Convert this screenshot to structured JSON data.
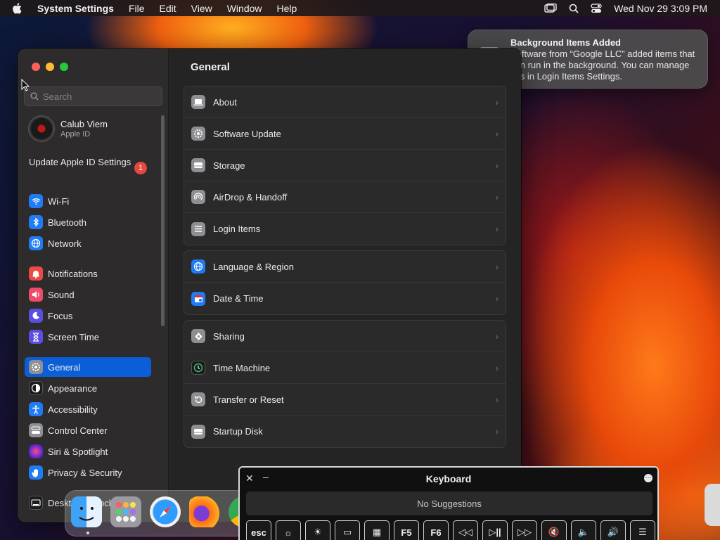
{
  "menubar": {
    "app_name": "System Settings",
    "menus": [
      "File",
      "Edit",
      "View",
      "Window",
      "Help"
    ],
    "clock": "Wed Nov 29  3:09 PM"
  },
  "sidebar": {
    "search_placeholder": "Search",
    "profile": {
      "name": "Calub Viem",
      "subtitle": "Apple ID"
    },
    "update_label": "Update Apple ID Settings",
    "update_badge": "1",
    "items": [
      {
        "label": "Wi-Fi",
        "icon": "wifi-icon",
        "color": "#1f7cf5"
      },
      {
        "label": "Bluetooth",
        "icon": "bluetooth-icon",
        "color": "#1f7cf5"
      },
      {
        "label": "Network",
        "icon": "globe-icon",
        "color": "#1f7cf5"
      },
      {
        "label": "Notifications",
        "icon": "bell-icon",
        "color": "#ee4a44"
      },
      {
        "label": "Sound",
        "icon": "speaker-icon",
        "color": "#ee4a6a"
      },
      {
        "label": "Focus",
        "icon": "moon-icon",
        "color": "#5a4fe0"
      },
      {
        "label": "Screen Time",
        "icon": "hourglass-icon",
        "color": "#5a4fe0"
      },
      {
        "label": "General",
        "icon": "gear-icon",
        "color": "#8e8e93"
      },
      {
        "label": "Appearance",
        "icon": "appearance-icon",
        "color": "#1c1c1c"
      },
      {
        "label": "Accessibility",
        "icon": "accessibility-icon",
        "color": "#1f7cf5"
      },
      {
        "label": "Control Center",
        "icon": "control-center-icon",
        "color": "#8e8e93"
      },
      {
        "label": "Siri & Spotlight",
        "icon": "siri-icon",
        "color": "#b03aa0"
      },
      {
        "label": "Privacy & Security",
        "icon": "hand-icon",
        "color": "#1f7cf5"
      },
      {
        "label": "Desktop & Dock",
        "icon": "desktop-icon",
        "color": "#1c1c1c"
      }
    ],
    "selected": "General"
  },
  "main": {
    "title": "General",
    "groups": [
      [
        {
          "label": "About",
          "icon": "laptop-icon",
          "color": "#8e8e93"
        },
        {
          "label": "Software Update",
          "icon": "gear-badge-icon",
          "color": "#8e8e93"
        },
        {
          "label": "Storage",
          "icon": "drive-icon",
          "color": "#8e8e93"
        },
        {
          "label": "AirDrop & Handoff",
          "icon": "airdrop-icon",
          "color": "#8e8e93"
        },
        {
          "label": "Login Items",
          "icon": "list-icon",
          "color": "#8e8e93"
        }
      ],
      [
        {
          "label": "Language & Region",
          "icon": "globe-icon",
          "color": "#1f7cf5"
        },
        {
          "label": "Date & Time",
          "icon": "calendar-clock-icon",
          "color": "#1f7cf5"
        }
      ],
      [
        {
          "label": "Sharing",
          "icon": "sharing-icon",
          "color": "#8e8e93"
        },
        {
          "label": "Time Machine",
          "icon": "time-machine-icon",
          "color": "#1a1a1a"
        },
        {
          "label": "Transfer or Reset",
          "icon": "reset-icon",
          "color": "#8e8e93"
        },
        {
          "label": "Startup Disk",
          "icon": "disk-icon",
          "color": "#8e8e93"
        }
      ]
    ]
  },
  "notification": {
    "title": "Background Items Added",
    "body": "Software from “Google LLC” added items that can run in the background. You can manage this in Login Items Settings."
  },
  "keyboard_viewer": {
    "title": "Keyboard",
    "suggestions": "No Suggestions",
    "keys": [
      "esc",
      "☼",
      "☀",
      "▭",
      "▦",
      "F5",
      "F6",
      "◁◁",
      "▷||",
      "▷▷",
      "🔇",
      "🔈",
      "🔊",
      "☰"
    ]
  }
}
